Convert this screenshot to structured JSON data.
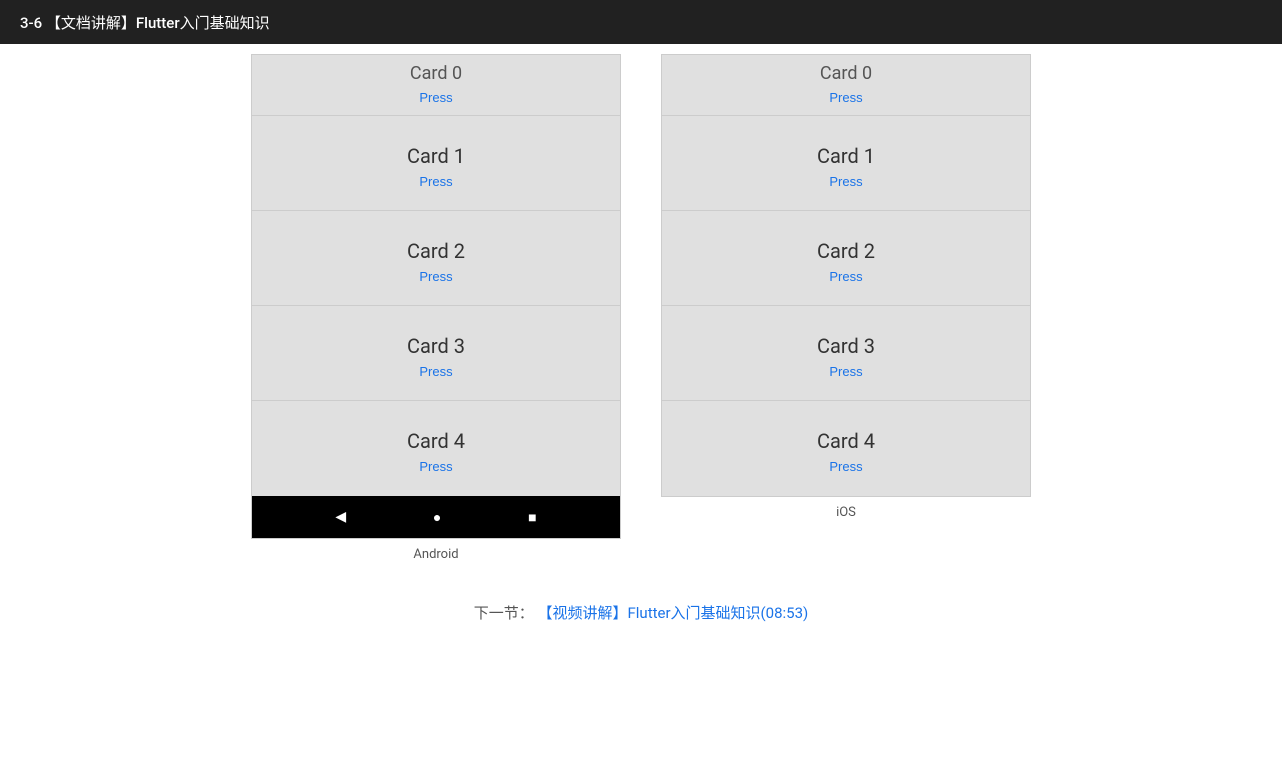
{
  "header": {
    "title": "3-6 【文档讲解】Flutter入门基础知识"
  },
  "android": {
    "label": "Android",
    "partial_card": {
      "title": "Card 0",
      "press": "Press"
    },
    "cards": [
      {
        "title": "Card 1",
        "press": "Press"
      },
      {
        "title": "Card 2",
        "press": "Press"
      },
      {
        "title": "Card 3",
        "press": "Press"
      },
      {
        "title": "Card 4",
        "press": "Press"
      }
    ],
    "nav": {
      "back": "◀",
      "home": "●",
      "recent": "■"
    }
  },
  "ios": {
    "label": "iOS",
    "partial_card": {
      "title": "Card 0",
      "press": "Press"
    },
    "cards": [
      {
        "title": "Card 1",
        "press": "Press"
      },
      {
        "title": "Card 2",
        "press": "Press"
      },
      {
        "title": "Card 3",
        "press": "Press"
      },
      {
        "title": "Card 4",
        "press": "Press"
      }
    ]
  },
  "next_section": {
    "prefix": "下一节：",
    "link_text": "【视频讲解】Flutter入门基础知识(08:53)"
  }
}
